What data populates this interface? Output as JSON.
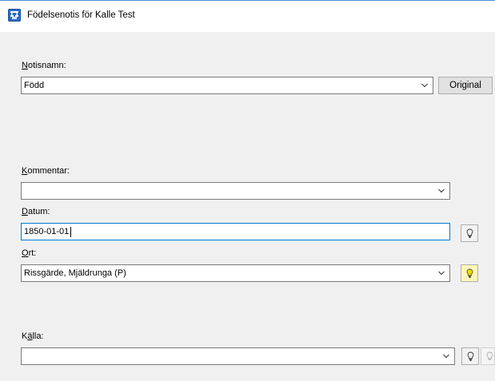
{
  "window": {
    "title": "Födelsenotis för Kalle Test",
    "icon": "family-tree-app-icon"
  },
  "notisnamn": {
    "label_hotkey": "N",
    "label_rest": "otisnamn:",
    "value": "Född",
    "original_button": "Original"
  },
  "kommentar": {
    "label_hotkey": "K",
    "label_rest": "ommentar:",
    "value": ""
  },
  "datum": {
    "label_hotkey": "D",
    "label_rest": "atum:",
    "value": "1850-01-01"
  },
  "ort": {
    "label_hotkey": "O",
    "label_rest": "rt:",
    "value": "Rissgärde, Mjäldrunga (P)"
  },
  "kalla": {
    "label_pre": "K",
    "label_hotkey": "ä",
    "label_rest": "lla:",
    "value": ""
  },
  "colors": {
    "accent": "#0078d7",
    "bulb_lit_bg": "#fbf7b8",
    "bulb_yellow": "#f5d800"
  }
}
